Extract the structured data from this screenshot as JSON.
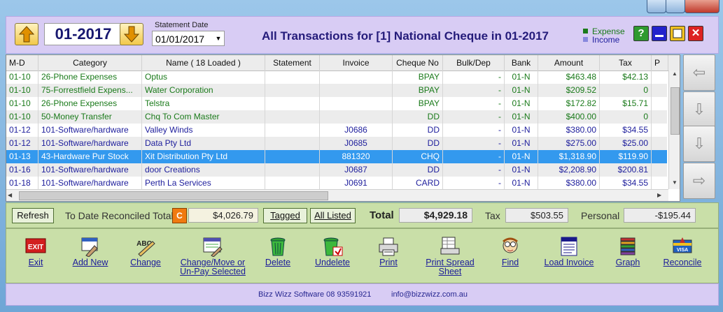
{
  "header": {
    "period": "01-2017",
    "statement_date_label": "Statement Date",
    "statement_date_value": "01/01/2017",
    "title": "All Transactions for [1] National Cheque in 01-2017",
    "legend": [
      {
        "label": "Expense",
        "color": "#1a7a1a"
      },
      {
        "label": "Income",
        "color": "#1d1d9c"
      }
    ]
  },
  "grid": {
    "columns": [
      "M-D",
      "Category",
      "Name   ( 18 Loaded )",
      "Statement",
      "Invoice",
      "Cheque No",
      "Bulk/Dep",
      "Bank",
      "Amount",
      "Tax",
      "P"
    ],
    "rows": [
      {
        "md": "01-10",
        "category": "26-Phone Expenses",
        "name": "Optus",
        "statement": "",
        "invoice": "",
        "cheque": "BPAY",
        "bulk": "-",
        "bank": "01-N",
        "amount": "$463.48",
        "tax": "$42.13",
        "type": "expense"
      },
      {
        "md": "01-10",
        "category": "75-Forrestfield Expens...",
        "name": "Water Corporation",
        "statement": "",
        "invoice": "",
        "cheque": "BPAY",
        "bulk": "-",
        "bank": "01-N",
        "amount": "$209.52",
        "tax": "0",
        "type": "expense"
      },
      {
        "md": "01-10",
        "category": "26-Phone Expenses",
        "name": "Telstra",
        "statement": "",
        "invoice": "",
        "cheque": "BPAY",
        "bulk": "-",
        "bank": "01-N",
        "amount": "$172.82",
        "tax": "$15.71",
        "type": "expense"
      },
      {
        "md": "01-10",
        "category": "50-Money Transfer",
        "name": "Chq To Com Master",
        "statement": "",
        "invoice": "",
        "cheque": "DD",
        "bulk": "-",
        "bank": "01-N",
        "amount": "$400.00",
        "tax": "0",
        "type": "expense"
      },
      {
        "md": "01-12",
        "category": "101-Software/hardware",
        "name": "Valley Winds",
        "statement": "",
        "invoice": "J0686",
        "cheque": "DD",
        "bulk": "-",
        "bank": "01-N",
        "amount": "$380.00",
        "tax": "$34.55",
        "type": "income"
      },
      {
        "md": "01-12",
        "category": "101-Software/hardware",
        "name": "Data Pty Ltd",
        "statement": "",
        "invoice": "J0685",
        "cheque": "DD",
        "bulk": "-",
        "bank": "01-N",
        "amount": "$275.00",
        "tax": "$25.00",
        "type": "income"
      },
      {
        "md": "01-13",
        "category": "43-Hardware Pur Stock",
        "name": "Xit Distribution Pty Ltd",
        "statement": "",
        "invoice": "881320",
        "cheque": "CHQ",
        "bulk": "-",
        "bank": "01-N",
        "amount": "$1,318.90",
        "tax": "$119.90",
        "type": "expense",
        "selected": true
      },
      {
        "md": "01-16",
        "category": "101-Software/hardware",
        "name": "door Creations",
        "statement": "",
        "invoice": "J0687",
        "cheque": "DD",
        "bulk": "-",
        "bank": "01-N",
        "amount": "$2,208.90",
        "tax": "$200.81",
        "type": "income"
      },
      {
        "md": "01-18",
        "category": "101-Software/hardware",
        "name": "Perth La Services",
        "statement": "",
        "invoice": "J0691",
        "cheque": "CARD",
        "bulk": "-",
        "bank": "01-N",
        "amount": "$380.00",
        "tax": "$34.55",
        "type": "income"
      }
    ]
  },
  "totals": {
    "refresh_label": "Refresh",
    "reconciled_label": "To Date Reconciled Total",
    "c_badge": "C",
    "reconciled_value": "$4,026.79",
    "tagged_label": "Tagged",
    "all_listed_label": "All Listed",
    "total_label": "Total",
    "total_value": "$4,929.18",
    "tax_label": "Tax",
    "tax_value": "$503.55",
    "personal_label": "Personal",
    "personal_value": "-$195.44"
  },
  "toolbar": [
    {
      "label": "Exit",
      "icon": "exit-icon"
    },
    {
      "label": "Add New",
      "icon": "add-new-icon"
    },
    {
      "label": "Change",
      "icon": "change-icon"
    },
    {
      "label": "Change/Move or\nUn-Pay Selected",
      "icon": "change-move-icon"
    },
    {
      "label": "Delete",
      "icon": "trash-icon"
    },
    {
      "label": "Undelete",
      "icon": "undelete-icon"
    },
    {
      "label": "Print",
      "icon": "printer-icon"
    },
    {
      "label": "Print Spread\nSheet",
      "icon": "spreadsheet-icon"
    },
    {
      "label": "Find",
      "icon": "find-icon"
    },
    {
      "label": "Load Invoice",
      "icon": "invoice-icon"
    },
    {
      "label": "Graph",
      "icon": "graph-icon"
    },
    {
      "label": "Reconcile",
      "icon": "reconcile-icon"
    }
  ],
  "footer": {
    "company": "Bizz Wizz Software  08 93591921",
    "email": "info@bizzwizz.com.au"
  }
}
